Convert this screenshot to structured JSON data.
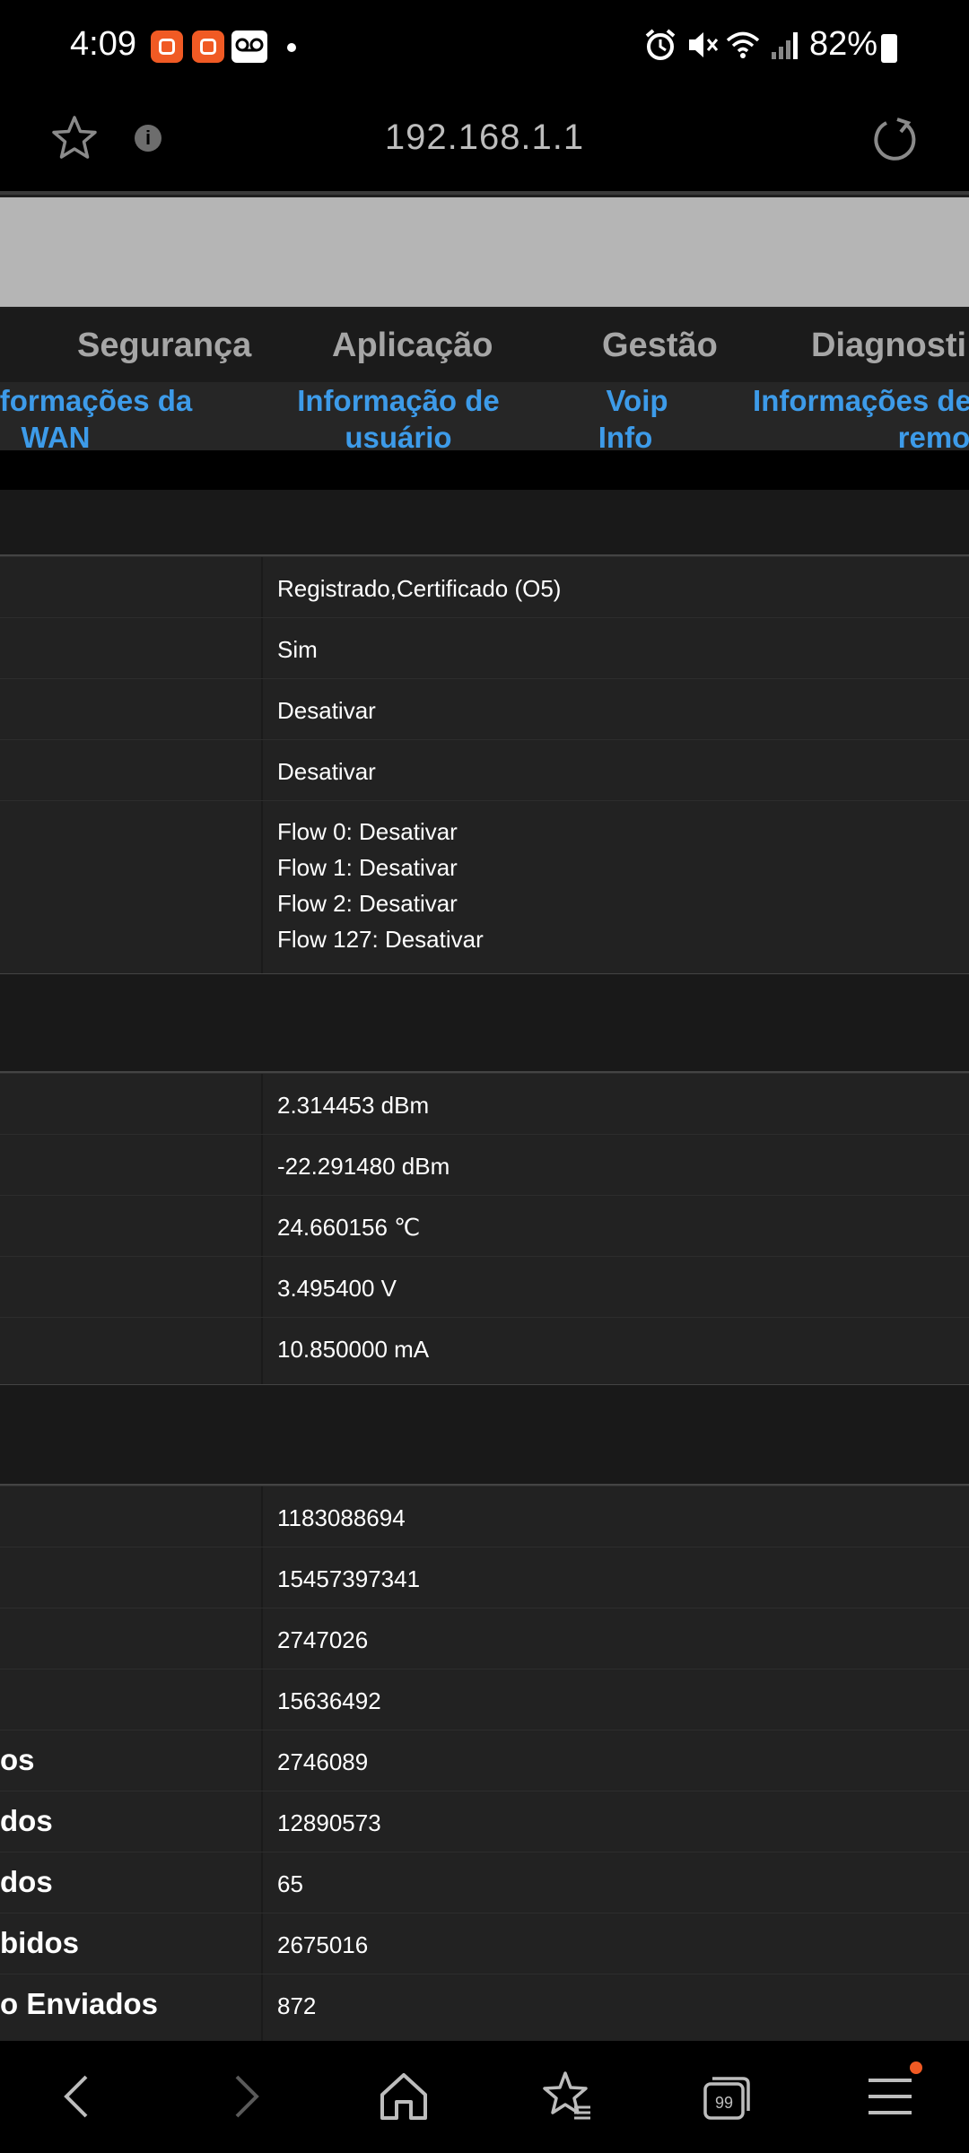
{
  "status_bar": {
    "time": "4:09",
    "battery": "82%",
    "icons": [
      "app-notification-icon",
      "app-notification-icon",
      "voicemail-icon",
      "alarm-icon",
      "mute-icon",
      "wifi-icon",
      "signal-icon",
      "battery-icon"
    ]
  },
  "browser": {
    "url": "192.168.1.1"
  },
  "menu": {
    "items": [
      "Segurança",
      "Aplicação",
      "Gestão",
      "Diagnosti"
    ]
  },
  "submenu": {
    "items": [
      {
        "line1": "formações da",
        "line2": "WAN"
      },
      {
        "line1": "Informação de",
        "line2": "usuário"
      },
      {
        "line1": "Voip",
        "line2": "Info"
      },
      {
        "line1": "Informações de",
        "line2": "remo"
      }
    ]
  },
  "section1": {
    "rows": [
      {
        "value": "Registrado,Certificado (O5)"
      },
      {
        "value": "Sim"
      },
      {
        "value": "Desativar"
      },
      {
        "value": "Desativar"
      }
    ],
    "flows": [
      "Flow 0: Desativar",
      "Flow 1: Desativar",
      "Flow 2: Desativar",
      "Flow 127: Desativar"
    ]
  },
  "section2": {
    "rows": [
      {
        "value": "2.314453 dBm"
      },
      {
        "value": "-22.291480 dBm"
      },
      {
        "value": "24.660156 ℃"
      },
      {
        "value": "3.495400 V"
      },
      {
        "value": "10.850000 mA"
      }
    ]
  },
  "section3": {
    "rows": [
      {
        "label": "",
        "value": "1183088694"
      },
      {
        "label": "",
        "value": "15457397341"
      },
      {
        "label": "",
        "value": "2747026"
      },
      {
        "label": "",
        "value": "15636492"
      },
      {
        "label": "os",
        "value": "2746089"
      },
      {
        "label": "dos",
        "value": "12890573"
      },
      {
        "label": "dos",
        "value": "65"
      },
      {
        "label": "bidos",
        "value": "2675016"
      },
      {
        "label": "o Enviados",
        "value": "872"
      }
    ]
  },
  "colors": {
    "link": "#3d9be9",
    "banner": "#b5b5b5",
    "notification": "#f05a24"
  }
}
